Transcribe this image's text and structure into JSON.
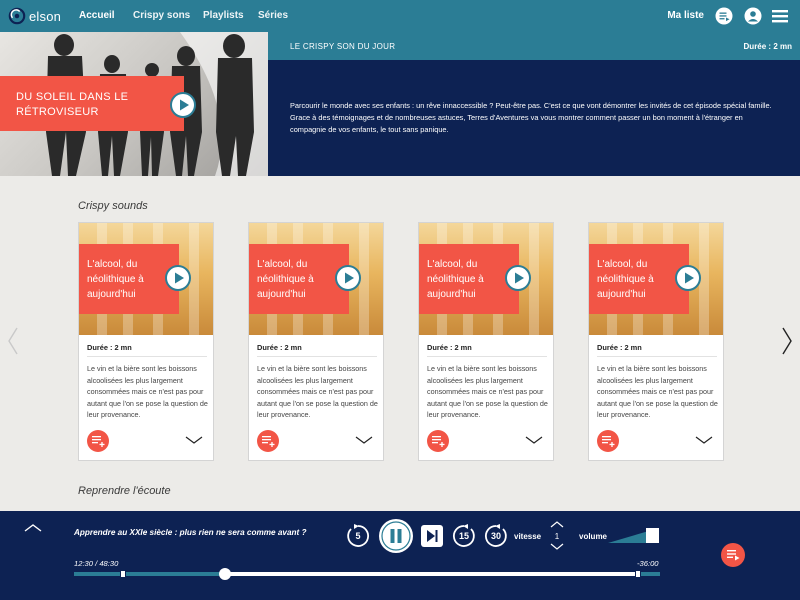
{
  "colors": {
    "teal": "#2b7d95",
    "navy": "#0d2253",
    "coral": "#f25546",
    "light_bg": "#ecebe8",
    "white": "#ffffff"
  },
  "nav": {
    "logo_text": "elson",
    "links": [
      "Accueil",
      "Crispy sons",
      "Playlists",
      "Séries"
    ],
    "active": "Accueil",
    "ma_liste": "Ma liste",
    "icons": [
      "playlist-icon",
      "user-icon",
      "menu-icon"
    ]
  },
  "hero": {
    "title": "DU SOLEIL DANS LE RÉTROVISEUR",
    "label": "LE CRISPY SON DU JOUR",
    "duration": "Durée : 2 mn",
    "description": "Parcourir le monde avec ses enfants : un rêve innaccessible ? Peut-être pas. C'est ce que vont démontrer les invités de cet épisode spécial famille. Grace à des témoignages et de nombreuses astuces, Terres d'Aventures va vous montrer comment passer un bon moment à l'étranger en compagnie de vos enfants, le tout sans panique."
  },
  "sections": {
    "crispy": "Crispy sounds",
    "resume": "Reprendre l'écoute"
  },
  "cards": [
    {
      "title": "L'alcool, du néolithique à aujourd'hui",
      "duration": "Durée : 2 mn",
      "description": "Le vin et la bière sont les boissons alcoolisées les plus largement consommées mais ce n'est pas pour autant que l'on se pose la question de leur provenance."
    },
    {
      "title": "L'alcool, du néolithique à aujourd'hui",
      "duration": "Durée : 2 mn",
      "description": "Le vin et la bière sont les boissons alcoolisées les plus largement consommées mais ce n'est pas pour autant que l'on se pose la question de leur provenance."
    },
    {
      "title": "L'alcool, du néolithique à aujourd'hui",
      "duration": "Durée : 2 mn",
      "description": "Le vin et la bière sont les boissons alcoolisées les plus largement consommées mais ce n'est pas pour autant que l'on se pose la question de leur provenance."
    },
    {
      "title": "L'alcool, du néolithique à aujourd'hui",
      "duration": "Durée : 2 mn",
      "description": "Le vin et la bière sont les boissons alcoolisées les plus largement consommées mais ce n'est pas pour autant que l'on se pose la question de leur provenance."
    }
  ],
  "player": {
    "title": "Apprendre au XXIe siècle : plus rien ne sera comme avant ?",
    "rewind_seconds": "5",
    "forward_15": "15",
    "forward_30": "30",
    "vitesse_label": "vitesse",
    "speed_value": "1",
    "volume_label": "volume",
    "time_elapsed": "12:30 / 48:30",
    "time_remaining": "-36:00",
    "progress": 0.2577,
    "volume_level": 1.0
  }
}
